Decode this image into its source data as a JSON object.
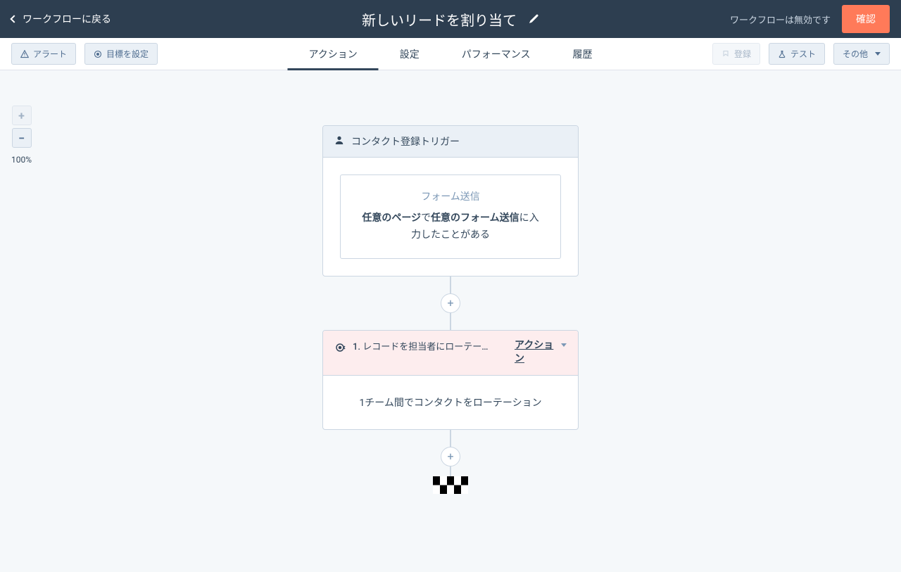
{
  "topbar": {
    "back_label": "ワークフローに戻る",
    "title": "新しいリードを割り当て",
    "status": "ワークフローは無効です",
    "confirm_label": "確認"
  },
  "toolbar": {
    "alerts_label": "アラート",
    "goals_label": "目標を設定",
    "register_label": "登録",
    "test_label": "テスト",
    "more_label": "その他"
  },
  "tabs": {
    "actions": "アクション",
    "settings": "設定",
    "performance": "パフォーマンス",
    "history": "履歴"
  },
  "zoom": {
    "level": "100%"
  },
  "trigger": {
    "header": "コンタクト登録トリガー",
    "subtitle": "フォーム送信",
    "text_prefix": "",
    "bold1": "任意のページ",
    "mid1": "で",
    "bold2": "任意のフォーム送信",
    "suffix": "に入力したことがある"
  },
  "action1": {
    "title": "1. レコードを担当者にローテー…",
    "menu_label": "アクション",
    "body": "1チーム間でコンタクトをローテーション"
  }
}
